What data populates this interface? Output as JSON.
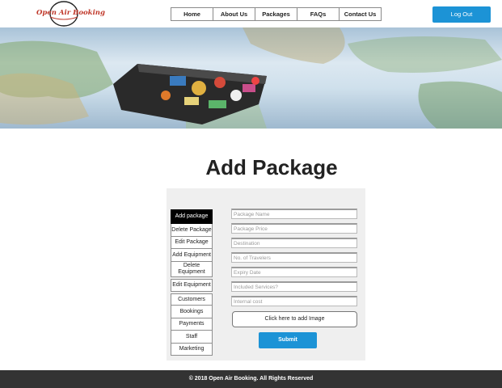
{
  "header": {
    "logo_text": "Open Air Booking",
    "nav": [
      {
        "label": "Home"
      },
      {
        "label": "About Us"
      },
      {
        "label": "Packages"
      },
      {
        "label": "FAQs"
      },
      {
        "label": "Contact Us"
      }
    ],
    "logout_label": "Log Out"
  },
  "colors": {
    "accent": "#1c93d6",
    "logo": "#c0392b",
    "footer_bg": "#333333",
    "panel_bg": "#efefef"
  },
  "main": {
    "title": "Add Package"
  },
  "side_menu": [
    {
      "label": "Add package",
      "active": true
    },
    {
      "label": "Delete Package"
    },
    {
      "label": "Edit Package"
    },
    {
      "label": "Add Equipment"
    },
    {
      "label": "Delete Equipment"
    },
    {
      "label": "Edit Equipment"
    },
    {
      "label": "Customers"
    },
    {
      "label": "Bookings"
    },
    {
      "label": "Payments"
    },
    {
      "label": "Staff"
    },
    {
      "label": "Marketing"
    }
  ],
  "form": {
    "package_name_placeholder": "Package Name",
    "package_price_placeholder": "Package Price",
    "destination_placeholder": "Destination",
    "travelers_placeholder": "No. of Travelers",
    "expiry_placeholder": "Expiry Date",
    "services_placeholder": "Included Services?",
    "internal_cost_placeholder": "Internal cost",
    "image_button_label": "Click here to add Image",
    "submit_label": "Submit"
  },
  "footer": {
    "text": "© 2018 Open Air Booking. All Rights Reserved"
  }
}
